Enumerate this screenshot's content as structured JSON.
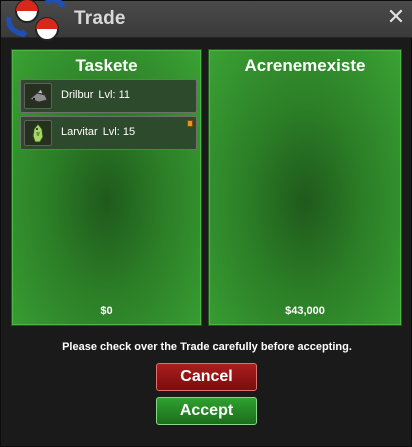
{
  "window": {
    "title": "Trade",
    "close_symbol": "✕"
  },
  "colors": {
    "panel_green": "#3aa234",
    "cancel_red": "#9b1616",
    "accept_green": "#279727",
    "held_item": "#e39a1b"
  },
  "left_panel": {
    "name": "Taskete",
    "money": "$0",
    "pokemon": [
      {
        "name": "Drilbur",
        "level": "Lvl: 11",
        "icon": "drilbur-sprite-icon",
        "held_item": false
      },
      {
        "name": "Larvitar",
        "level": "Lvl: 15",
        "icon": "larvitar-sprite-icon",
        "held_item": true
      }
    ]
  },
  "right_panel": {
    "name": "Acrenemexiste",
    "money": "$43,000",
    "pokemon": []
  },
  "notice": "Please check over the Trade carefully before accepting.",
  "buttons": {
    "cancel": "Cancel",
    "accept": "Accept"
  }
}
